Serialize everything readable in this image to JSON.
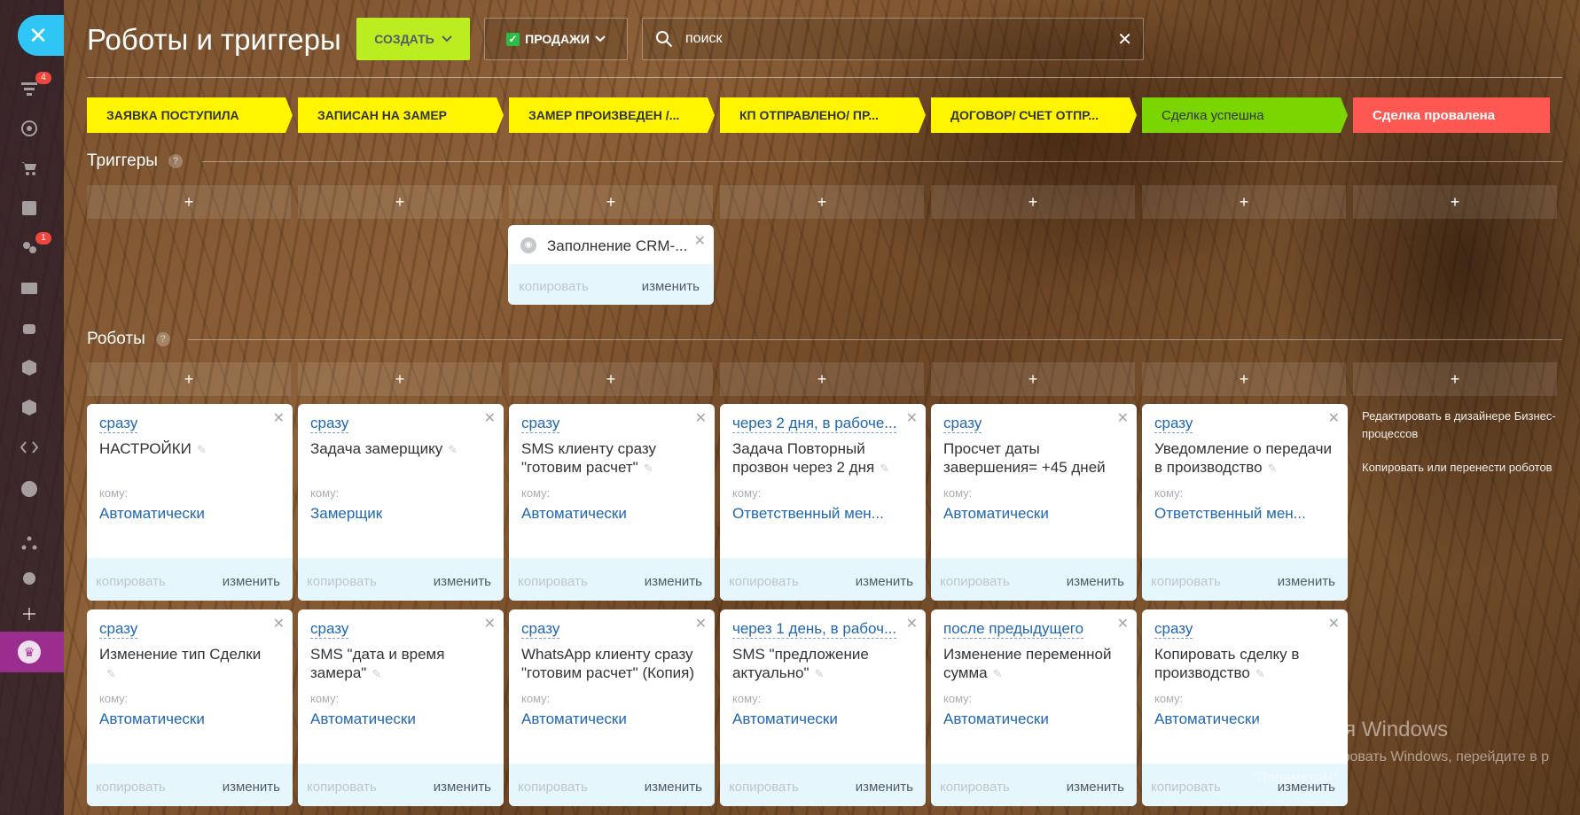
{
  "sidebar": {
    "close_icon": "✕",
    "badges": {
      "notifications": "4",
      "contacts": "1"
    }
  },
  "header": {
    "title": "Роботы и триггеры",
    "create_label": "СОЗДАТЬ",
    "pipeline_label": "ПРОДАЖИ",
    "search_placeholder": "поиск"
  },
  "stages": [
    {
      "label": "ЗАЯВКА ПОСТУПИЛА",
      "color": "#fff500"
    },
    {
      "label": "ЗАПИСАН НА ЗАМЕР",
      "color": "#fff500"
    },
    {
      "label": "ЗАМЕР ПРОИЗВЕДЕН /...",
      "color": "#fff500"
    },
    {
      "label": "КП ОТПРАВЛЕНО/ ПР...",
      "color": "#fff500"
    },
    {
      "label": "ДОГОВОР/ СЧЕТ ОТПР...",
      "color": "#fff500"
    },
    {
      "label": "Сделка успешна",
      "color": "#7bd500"
    },
    {
      "label": "Сделка провалена",
      "color": "#ff5752"
    }
  ],
  "triggers": {
    "title": "Триггеры",
    "help": "?",
    "add": "+",
    "card": {
      "name": "Заполнение CRM-...",
      "copy": "копировать",
      "edit": "изменить"
    }
  },
  "robots": {
    "title": "Роботы",
    "help": "?",
    "add": "+",
    "to_label": "кому:",
    "copy": "копировать",
    "edit": "изменить",
    "row1": [
      {
        "delay": "сразу",
        "title": "НАСТРОЙКИ",
        "to": "Автоматически"
      },
      {
        "delay": "сразу",
        "title": "Задача замерщику",
        "to": "Замерщик"
      },
      {
        "delay": "сразу",
        "title": "SMS клиенту сразу \"готовим расчет\"",
        "to": "Автоматически"
      },
      {
        "delay": "через 2 дня, в рабоче...",
        "title": "Задача Повторный прозвон через 2 дня",
        "to": "Ответственный мен..."
      },
      {
        "delay": "сразу",
        "title": "Просчет даты завершения= +45 дней",
        "to": "Автоматически"
      },
      {
        "delay": "сразу",
        "title": "Уведомление о передачи в производство",
        "to": "Ответственный мен..."
      }
    ],
    "row2": [
      {
        "delay": "сразу",
        "title": "Изменение тип Сделки",
        "to": "Автоматически"
      },
      {
        "delay": "сразу",
        "title": "SMS \"дата и время замера\"",
        "to": "Автоматически"
      },
      {
        "delay": "сразу",
        "title": "WhatsApp клиенту сразу \"готовим расчет\" (Копия)",
        "to": "Автоматически"
      },
      {
        "delay": "через 1 день, в рабоч...",
        "title": "SMS \"предложение актуально\"",
        "to": "Автоматически"
      },
      {
        "delay": "после предыдущего",
        "title": "Изменение переменной сумма",
        "to": "Автоматически"
      },
      {
        "delay": "сразу",
        "title": "Копировать сделку в производство",
        "to": "Автоматически"
      }
    ],
    "side_links": {
      "designer": "Редактировать в дизайнере Бизнес-процессов",
      "copy_move": "Копировать или перенести роботов"
    }
  },
  "watermark": {
    "line1": "Активация Windows",
    "line2": "Чтобы активировать Windows, перейдите в р",
    "line3": "\"Параметры\"."
  }
}
